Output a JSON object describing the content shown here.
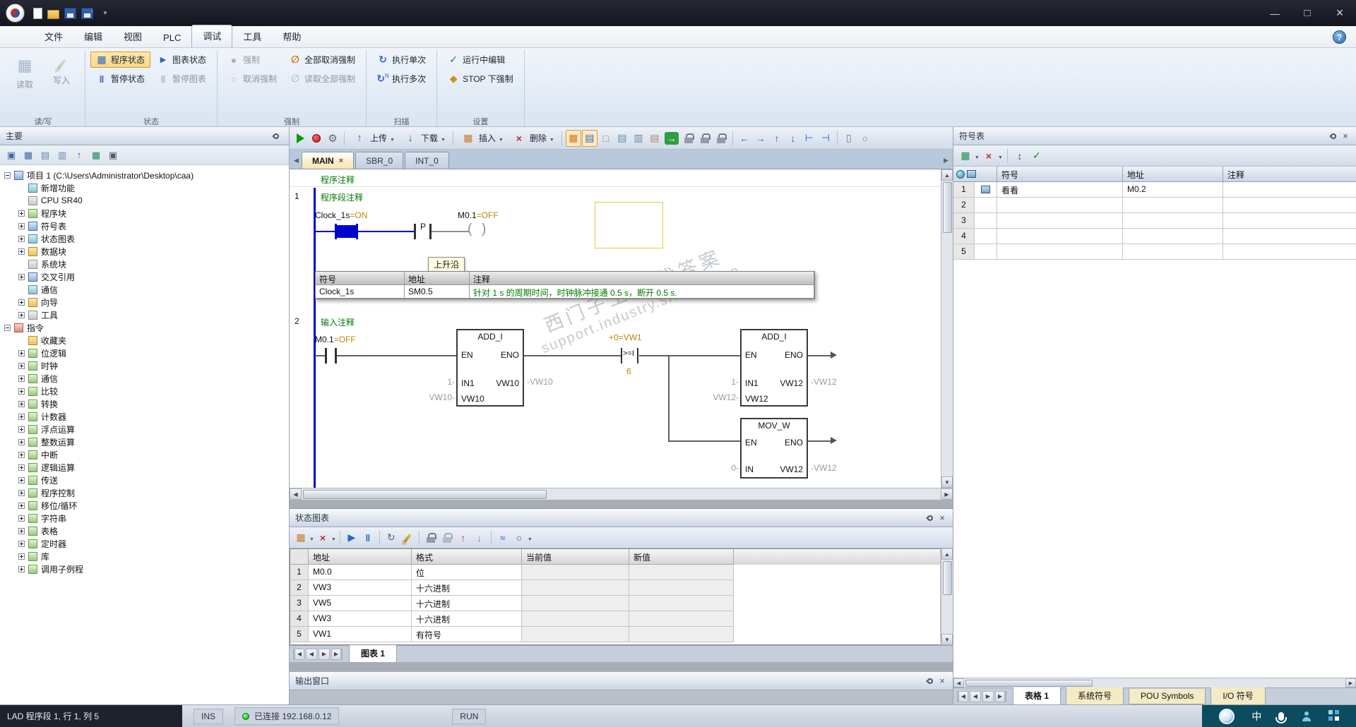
{
  "menu": {
    "items": [
      "文件",
      "编辑",
      "视图",
      "PLC",
      "调试",
      "工具",
      "帮助"
    ]
  },
  "ribbon": {
    "read_write": {
      "label": "读/写",
      "read": "读取",
      "write": "写入"
    },
    "status": {
      "label": "状态",
      "program": "程序状态",
      "chart": "图表状态",
      "pause": "暂停状态",
      "pause_chart": "暂停图表"
    },
    "force": {
      "label": "强制",
      "force": "强制",
      "unforce": "取消强制",
      "unforce_all": "全部取消强制",
      "read_all": "读取全部强制"
    },
    "scan": {
      "label": "扫描",
      "single": "执行单次",
      "multiple": "执行多次"
    },
    "settings": {
      "label": "设置",
      "run_edit": "运行中编辑",
      "stop_force": "STOP 下强制"
    }
  },
  "project_tree": {
    "title": "主要",
    "items": [
      "项目 1 (C:\\Users\\Administrator\\Desktop\\caa)",
      "新增功能",
      "CPU SR40",
      "程序块",
      "符号表",
      "状态图表",
      "数据块",
      "系统块",
      "交叉引用",
      "通信",
      "向导",
      "工具",
      "指令",
      "收藏夹",
      "位逻辑",
      "时钟",
      "通信",
      "比较",
      "转换",
      "计数器",
      "浮点运算",
      "整数运算",
      "中断",
      "逻辑运算",
      "传送",
      "程序控制",
      "移位/循环",
      "字符串",
      "表格",
      "定时器",
      "库",
      "调用子例程"
    ]
  },
  "editor": {
    "toolbar": {
      "upload": "上传",
      "download": "下载",
      "insert": "插入",
      "remove": "删除"
    },
    "tabs": [
      "MAIN",
      "SBR_0",
      "INT_0"
    ],
    "pou_comment": "程序注释",
    "net1": {
      "number": "1",
      "comment": "程序段注释",
      "contact_label": "Clock_1s",
      "contact_state": "=ON",
      "edge": "P",
      "coil_label": "M0.1",
      "coil_state": "=OFF",
      "edge_tooltip": "上升沿",
      "info_h1": "符号",
      "info_h2": "地址",
      "info_h3": "注释",
      "info_symbol": "Clock_1s",
      "info_address": "SM0.5",
      "info_comment": "针对 1 s 的周期时间，时钟脉冲接通 0.5 s，断开 0.5 s."
    },
    "net2": {
      "number": "2",
      "comment": "输入注释",
      "contact_label": "M0.1",
      "contact_state": "=OFF",
      "box1": {
        "title": "ADD_I",
        "en": "EN",
        "eno": "ENO",
        "in1": "IN1",
        "in1_val": "1-",
        "out": "VW10",
        "out_val": "-VW10",
        "in2_val": "VW10-",
        "in2": "VW10"
      },
      "cmp": {
        "above": "+0=VW1",
        "op": ">=I",
        "below": "6"
      },
      "box2": {
        "title": "ADD_I",
        "en": "EN",
        "eno": "ENO",
        "in1": "IN1",
        "in1_val": "1-",
        "out": "VW12",
        "out_val": "-VW12",
        "in2_val": "VW12-",
        "in2": "VW12"
      },
      "box3": {
        "title": "MOV_W",
        "en": "EN",
        "eno": "ENO",
        "in": "IN",
        "in_val": "0-",
        "out": "VW12",
        "out_val": "-VW12"
      }
    },
    "watermark1": "西门子工业 找答案",
    "watermark2": "support.industry.siemens.cn"
  },
  "status_chart": {
    "title": "状态图表",
    "h_address": "地址",
    "h_format": "格式",
    "h_current": "当前值",
    "h_new": "新值",
    "rows": [
      {
        "n": "1",
        "address": "M0.0",
        "format": "位",
        "current": "",
        "new_value": ""
      },
      {
        "n": "2",
        "address": "VW3",
        "format": "十六进制",
        "current": "",
        "new_value": ""
      },
      {
        "n": "3",
        "address": "VW5",
        "format": "十六进制",
        "current": "",
        "new_value": ""
      },
      {
        "n": "4",
        "address": "VW3",
        "format": "十六进制",
        "current": "",
        "new_value": ""
      },
      {
        "n": "5",
        "address": "VW1",
        "format": "有符号",
        "current": "",
        "new_value": ""
      }
    ],
    "tab": "图表 1"
  },
  "output": {
    "title": "输出窗口"
  },
  "symbol_table": {
    "title": "符号表",
    "h_symbol": "符号",
    "h_address": "地址",
    "h_comment": "注释",
    "rows": [
      {
        "n": "1",
        "symbol": "看看",
        "address": "M0.2",
        "comment": ""
      },
      {
        "n": "2",
        "symbol": "",
        "address": "",
        "comment": ""
      },
      {
        "n": "3",
        "symbol": "",
        "address": "",
        "comment": ""
      },
      {
        "n": "4",
        "symbol": "",
        "address": "",
        "comment": ""
      },
      {
        "n": "5",
        "symbol": "",
        "address": "",
        "comment": ""
      }
    ],
    "tabs": [
      "表格 1",
      "系统符号",
      "POU Symbols",
      "I/O 符号"
    ]
  },
  "statusbar": {
    "position": "LAD 程序段 1, 行 1, 列 5",
    "ins": "INS",
    "connection": "已连接 192.168.0.12",
    "mode": "RUN",
    "ime_cn": "中"
  }
}
